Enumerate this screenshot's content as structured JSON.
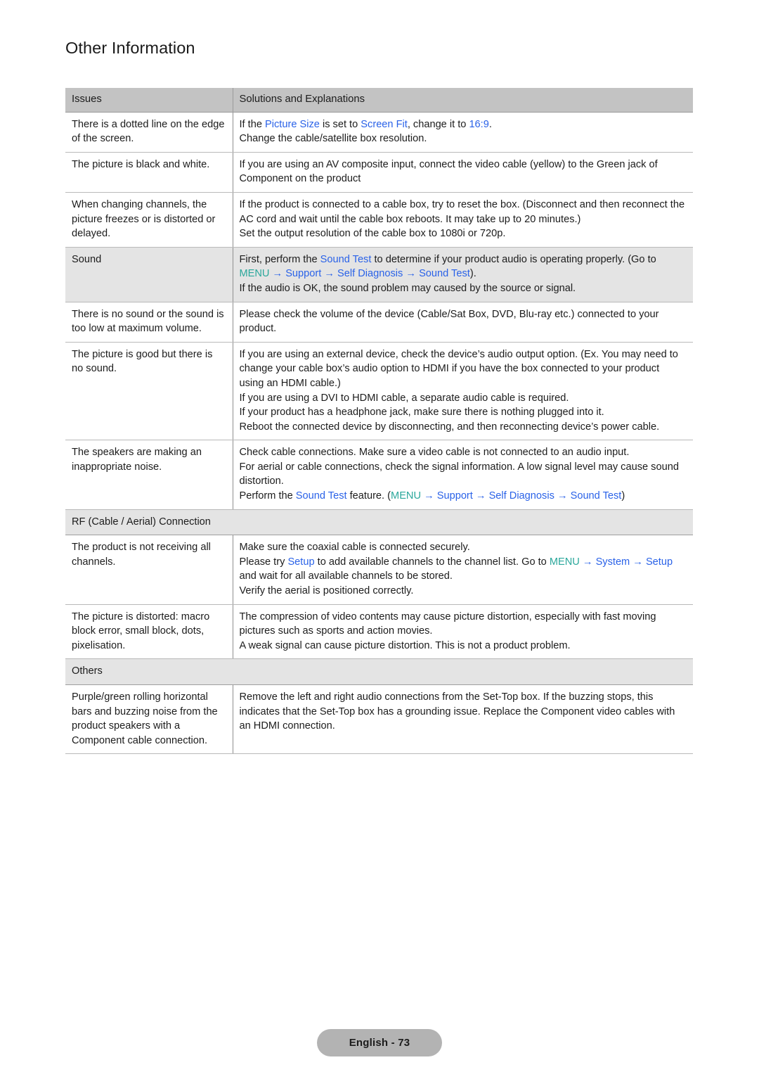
{
  "page": {
    "title": "Other Information",
    "footer_label": "English - 73"
  },
  "colors": {
    "link_blue": "#2a62e8",
    "menu_teal": "#2aa79b",
    "header_grey": "#c3c3c3",
    "section_grey": "#e4e4e4",
    "footer_badge_grey": "#b3b3b3"
  },
  "table": {
    "headers": {
      "issues": "Issues",
      "solutions": "Solutions and Explanations"
    },
    "rows": [
      {
        "type": "data",
        "shaded": false,
        "issue": "There is a dotted line on the edge of the screen.",
        "solution_paragraphs": [
          "If the Picture Size is set to Screen Fit, change it to 16:9.",
          "Change the cable/satellite box resolution."
        ]
      },
      {
        "type": "data",
        "shaded": false,
        "issue": "The picture is black and white.",
        "solution_paragraphs": [
          "If you are using an AV composite input, connect the video cable (yellow) to the Green jack of Component on the product"
        ]
      },
      {
        "type": "data",
        "shaded": false,
        "issue": "When changing channels, the picture freezes or is distorted or delayed.",
        "solution_paragraphs": [
          "If the product is connected to a cable box, try to reset the box. (Disconnect and then reconnect the AC cord and wait until the cable box reboots. It may take up to 20 minutes.)",
          "Set the output resolution of the cable box to 1080i or 720p."
        ]
      },
      {
        "type": "data",
        "shaded": true,
        "issue": "Sound",
        "solution_paragraphs": [
          "First, perform the Sound Test to determine if your product audio is operating properly. (Go to MENU → Support → Self Diagnosis → Sound Test).",
          "If the audio is OK, the sound problem may caused by the source or signal."
        ]
      },
      {
        "type": "data",
        "shaded": false,
        "issue": "There is no sound or the sound is too low at maximum volume.",
        "solution_paragraphs": [
          "Please check the volume of the device (Cable/Sat Box, DVD, Blu-ray etc.) connected to your product."
        ]
      },
      {
        "type": "data",
        "shaded": false,
        "issue": "The picture is good but there is no sound.",
        "solution_paragraphs": [
          "If you are using an external device, check the device’s audio output option. (Ex. You may need to change your cable box’s audio option to HDMI if you have the box connected to your product using an HDMI cable.)",
          "If you are using a DVI to HDMI cable, a separate audio cable is required.",
          "If your product has a headphone jack, make sure there is nothing plugged into it.",
          "Reboot the connected device by disconnecting, and then reconnecting device’s power cable."
        ]
      },
      {
        "type": "data",
        "shaded": false,
        "issue": "The speakers are making an inappropriate noise.",
        "solution_paragraphs": [
          "Check cable connections. Make sure a video cable is not connected to an audio input.",
          "For aerial or cable connections, check the signal information. A low signal level may cause sound distortion.",
          "Perform the Sound Test feature. (MENU → Support → Self Diagnosis → Sound Test)"
        ]
      },
      {
        "type": "section",
        "label": "RF (Cable / Aerial) Connection"
      },
      {
        "type": "data",
        "shaded": false,
        "issue": "The product is not receiving all channels.",
        "solution_paragraphs": [
          "Make sure the coaxial cable is connected securely.",
          "Please try Setup to add available channels to the channel list. Go to MENU → System → Setup and wait for all available channels to be stored.",
          "Verify the aerial is positioned correctly."
        ]
      },
      {
        "type": "data",
        "shaded": false,
        "issue": "The picture is distorted: macro block error, small block, dots, pixelisation.",
        "solution_paragraphs": [
          "The compression of video contents may cause picture distortion, especially with fast moving pictures such as sports and action movies.",
          "A weak signal can cause picture distortion. This is not a product problem."
        ]
      },
      {
        "type": "section",
        "label": "Others"
      },
      {
        "type": "data",
        "shaded": false,
        "issue": "Purple/green rolling horizontal bars and buzzing noise from the product speakers with a Component cable connection.",
        "solution_paragraphs": [
          "Remove the left and right audio connections from the Set-Top box. If the buzzing stops, this indicates that the Set-Top box has a grounding issue. Replace the Component video cables with an HDMI connection."
        ]
      }
    ],
    "highlight_terms": {
      "blue": [
        "Picture Size",
        "Screen Fit",
        "16:9",
        "Sound Test",
        "Support",
        "Self Diagnosis",
        "System",
        "Setup"
      ],
      "teal": [
        "MENU"
      ]
    }
  }
}
